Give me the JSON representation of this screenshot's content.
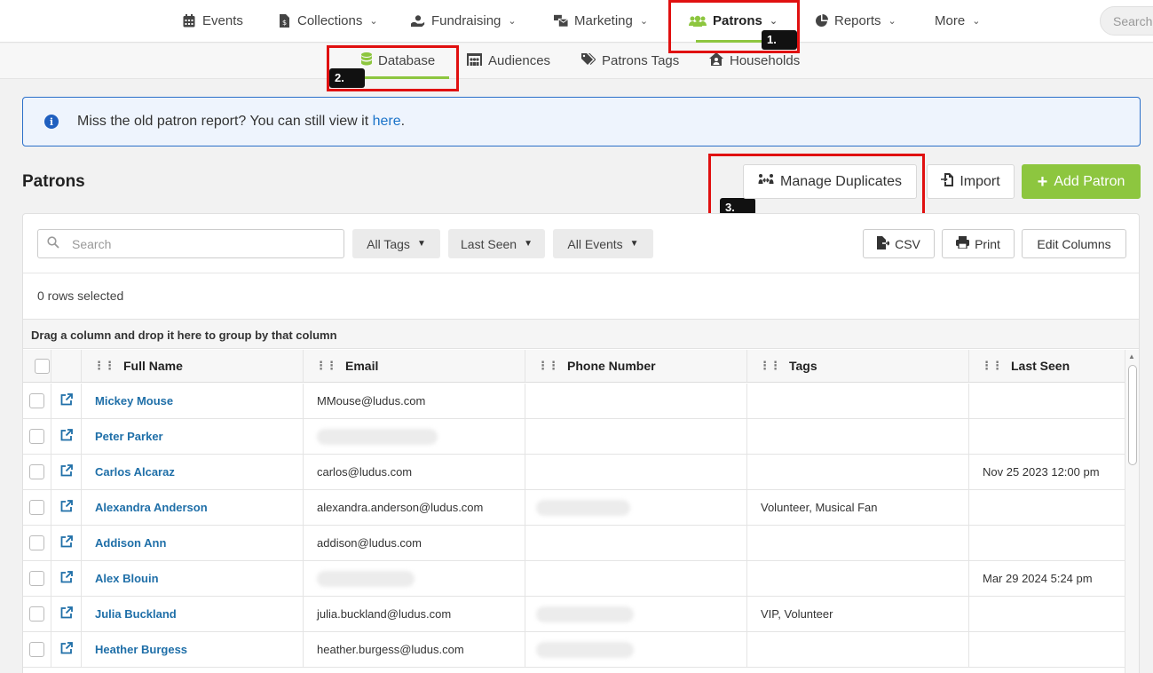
{
  "topnav": {
    "items": [
      {
        "label": "Events",
        "icon": "calendar-icon"
      },
      {
        "label": "Collections",
        "icon": "money-bill-icon"
      },
      {
        "label": "Fundraising",
        "icon": "hand-donate-icon"
      },
      {
        "label": "Marketing",
        "icon": "mail-bulk-icon"
      },
      {
        "label": "Patrons",
        "icon": "users-icon",
        "active": true
      },
      {
        "label": "Reports",
        "icon": "pie-chart-icon"
      },
      {
        "label": "More"
      }
    ],
    "search_placeholder": "Search"
  },
  "subnav": {
    "items": [
      {
        "label": "Database",
        "icon": "database-icon",
        "active": true
      },
      {
        "label": "Audiences",
        "icon": "audiences-icon"
      },
      {
        "label": "Patrons Tags",
        "icon": "tags-icon"
      },
      {
        "label": "Households",
        "icon": "house-user-icon"
      }
    ]
  },
  "annotations": [
    "1.",
    "2.",
    "3."
  ],
  "alert": {
    "text": "Miss the old patron report? You can still view it ",
    "link": "here",
    "suffix": "."
  },
  "page": {
    "title": "Patrons"
  },
  "actions": {
    "manage_duplicates": "Manage Duplicates",
    "import": "Import",
    "add_patron": "Add Patron"
  },
  "toolbar": {
    "search_placeholder": "Search",
    "all_tags": "All Tags",
    "last_seen": "Last Seen",
    "all_events": "All Events",
    "csv": "CSV",
    "print": "Print",
    "edit_columns": "Edit Columns"
  },
  "rows_selected": "0 rows selected",
  "group_hint": "Drag a column and drop it here to group by that column",
  "columns": [
    "Full Name",
    "Email",
    "Phone Number",
    "Tags",
    "Last Seen"
  ],
  "rows": [
    {
      "name": "Mickey Mouse",
      "email": "MMouse@ludus.com",
      "phone": "",
      "tags": "",
      "last_seen": ""
    },
    {
      "name": "Peter Parker",
      "email": "",
      "phone": "",
      "tags": "",
      "last_seen": ""
    },
    {
      "name": "Carlos Alcaraz",
      "email": "carlos@ludus.com",
      "phone": "",
      "tags": "",
      "last_seen": "Nov 25 2023 12:00 pm"
    },
    {
      "name": "Alexandra Anderson",
      "email": "alexandra.anderson@ludus.com",
      "phone": "",
      "tags": "Volunteer, Musical Fan",
      "last_seen": ""
    },
    {
      "name": "Addison Ann",
      "email": "addison@ludus.com",
      "phone": "",
      "tags": "",
      "last_seen": ""
    },
    {
      "name": "Alex Blouin",
      "email": "",
      "phone": "",
      "tags": "",
      "last_seen": "Mar 29 2024 5:24 pm"
    },
    {
      "name": "Julia Buckland",
      "email": "julia.buckland@ludus.com",
      "phone": "",
      "tags": "VIP, Volunteer",
      "last_seen": ""
    },
    {
      "name": "Heather Burgess",
      "email": "heather.burgess@ludus.com",
      "phone": "",
      "tags": "",
      "last_seen": ""
    }
  ],
  "colors": {
    "accent": "#8dc63f",
    "link": "#1f6fa8",
    "annotation": "#e01010",
    "info": "#1f5fbf"
  }
}
